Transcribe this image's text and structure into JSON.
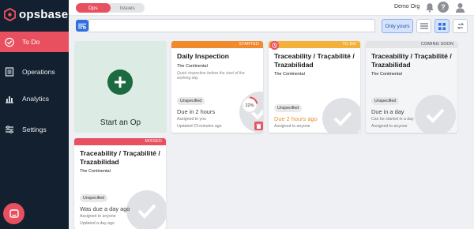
{
  "brand": {
    "name": "opsbase"
  },
  "sidebar": {
    "items": [
      {
        "label": "To Do",
        "icon": "check-circle-icon"
      },
      {
        "label": "Operations",
        "icon": "list-icon"
      },
      {
        "label": "Analytics",
        "icon": "chart-icon"
      },
      {
        "label": "Settings",
        "icon": "sliders-icon"
      }
    ]
  },
  "topbar": {
    "tabs": [
      "Ops",
      "Issues"
    ],
    "org": "Demo Org"
  },
  "toolbar": {
    "search_value": "",
    "only_yours": "Only yours"
  },
  "start_card": {
    "label": "Start an Op"
  },
  "cards": [
    {
      "status": "STARTED",
      "status_color": "#f08a2c",
      "title": "Daily Inspection",
      "subtitle": "The Continental",
      "description": "Quick inspection before the start of the working day.",
      "badge": "Unspecified",
      "due": "Due in 2 hours",
      "assigned": "Assigned to you",
      "updated": "Updated 23 minutes ago",
      "progress_percent": 22,
      "progress_label": "22%"
    },
    {
      "status": "TO DO",
      "status_color": "#f3b13a",
      "title": "Traceability / Traçabilité / Trazabilidad",
      "subtitle": "The Continental",
      "badge": "Unspecified",
      "due": "Due 2 hours ago",
      "due_color": "#e8902e",
      "assigned": "Assigned to anyone"
    },
    {
      "status": "COMING SOON",
      "status_color": "#e3e4e6",
      "title": "Traceability / Traçabilité / Trazabilidad",
      "subtitle": "The Continental",
      "badge": "Unspecified",
      "due": "Due in a day",
      "assigned": "Can be started in a day",
      "updated": "Assigned to anyone"
    },
    {
      "status": "MISSED",
      "status_color": "#e8505f",
      "title": "Traceability / Traçabilité / Trazabilidad",
      "subtitle": "The Continental",
      "badge": "Unspecified",
      "due": "Was due a day ago",
      "assigned": "Assigned to anyone",
      "updated": "Updated a day ago"
    }
  ],
  "colors": {
    "accent": "#e8505f",
    "sidebar": "#13202f",
    "primary": "#2f6fe0",
    "start_bg": "#dcece4",
    "start_plus": "#1c6a40"
  }
}
